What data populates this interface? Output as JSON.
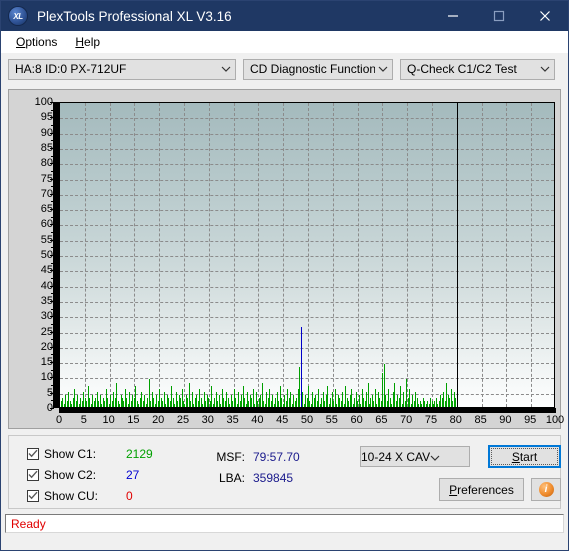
{
  "window": {
    "title": "PlexTools Professional XL V3.16",
    "app_icon": "xl-logo-icon",
    "minimize": "minimize-icon",
    "maximize": "maximize-icon",
    "close": "close-icon"
  },
  "menu": {
    "items": [
      {
        "label": "Options",
        "mnemonic": "O"
      },
      {
        "label": "Help",
        "mnemonic": "H"
      }
    ]
  },
  "toolbar": {
    "drive_select": "HA:8 ID:0  PX-712UF",
    "function_select": "CD Diagnostic Functions",
    "test_select": "Q-Check C1/C2 Test"
  },
  "panel": {
    "checkboxes": [
      {
        "label": "Show C1:",
        "value": "2129",
        "color": "#00a000",
        "checked": true
      },
      {
        "label": "Show C2:",
        "value": "27",
        "color": "#0000d0",
        "checked": true
      },
      {
        "label": "Show CU:",
        "value": "0",
        "color": "#e00000",
        "checked": true
      }
    ],
    "msf_key": "MSF:",
    "msf_value": "79:57.70",
    "lba_key": "LBA:",
    "lba_value": "359845",
    "speed_select": "10-24 X CAV",
    "start_button": "Start",
    "preferences_button": "Preferences",
    "info_button": "info-icon"
  },
  "statusbar": {
    "text": "Ready"
  },
  "chart_data": {
    "type": "bar",
    "title": "Q-Check C1/C2 Test",
    "xlabel": "",
    "ylabel": "",
    "xlim": [
      0,
      100
    ],
    "ylim": [
      0,
      100
    ],
    "xticks": [
      0,
      5,
      10,
      15,
      20,
      25,
      30,
      35,
      40,
      45,
      50,
      55,
      60,
      65,
      70,
      75,
      80,
      85,
      90,
      95,
      100
    ],
    "yticks": [
      0,
      5,
      10,
      15,
      20,
      25,
      30,
      35,
      40,
      45,
      50,
      55,
      60,
      65,
      70,
      75,
      80,
      85,
      90,
      95,
      100
    ],
    "grid": true,
    "legend": [
      "C1",
      "C2",
      "CU"
    ],
    "legend_position": "bottom-left-panel",
    "data_end_marker": 80,
    "series": [
      {
        "name": "C1",
        "color": "#00a000",
        "x": [
          0.2,
          0.5,
          0.8,
          1.1,
          1.4,
          1.7,
          2.0,
          2.3,
          2.6,
          2.9,
          3.2,
          3.5,
          3.8,
          4.1,
          4.4,
          4.7,
          5.0,
          5.3,
          5.6,
          5.9,
          6.2,
          6.5,
          6.8,
          7.1,
          7.4,
          7.7,
          8.0,
          8.3,
          8.6,
          8.9,
          9.2,
          9.5,
          9.8,
          10.1,
          10.4,
          10.7,
          11.0,
          11.3,
          11.6,
          11.9,
          12.2,
          12.5,
          12.8,
          13.1,
          13.4,
          13.7,
          14.0,
          14.3,
          14.6,
          14.9,
          15.2,
          15.5,
          15.8,
          16.1,
          16.4,
          16.7,
          17.0,
          17.3,
          17.6,
          17.9,
          18.2,
          18.5,
          18.8,
          19.1,
          19.4,
          19.7,
          20.0,
          20.3,
          20.6,
          20.9,
          21.2,
          21.5,
          21.8,
          22.1,
          22.4,
          22.7,
          23.0,
          23.3,
          23.6,
          23.9,
          24.2,
          24.5,
          24.8,
          25.1,
          25.4,
          25.7,
          26.0,
          26.3,
          26.6,
          26.9,
          27.2,
          27.5,
          27.8,
          28.1,
          28.4,
          28.7,
          29.0,
          29.3,
          29.6,
          29.9,
          30.2,
          30.5,
          30.8,
          31.1,
          31.4,
          31.7,
          32.0,
          32.3,
          32.6,
          32.9,
          33.2,
          33.5,
          33.8,
          34.1,
          34.4,
          34.7,
          35.0,
          35.3,
          35.6,
          35.9,
          36.2,
          36.5,
          36.8,
          37.1,
          37.4,
          37.7,
          38.0,
          38.3,
          38.6,
          38.9,
          39.2,
          39.5,
          39.8,
          40.1,
          40.4,
          40.7,
          41.0,
          41.3,
          41.6,
          41.9,
          42.2,
          42.5,
          42.8,
          43.1,
          43.4,
          43.7,
          44.0,
          44.3,
          44.6,
          44.9,
          45.2,
          45.5,
          45.8,
          46.1,
          46.4,
          46.7,
          47.0,
          47.3,
          47.6,
          47.9,
          48.2,
          48.5,
          48.8,
          49.1,
          49.4,
          49.7,
          50.0,
          50.3,
          50.6,
          50.9,
          51.2,
          51.5,
          51.8,
          52.1,
          52.4,
          52.7,
          53.0,
          53.3,
          53.6,
          53.9,
          54.2,
          54.5,
          54.8,
          55.1,
          55.4,
          55.7,
          56.0,
          56.3,
          56.6,
          56.9,
          57.2,
          57.5,
          57.8,
          58.1,
          58.4,
          58.7,
          59.0,
          59.3,
          59.6,
          59.9,
          60.2,
          60.5,
          60.8,
          61.1,
          61.4,
          61.7,
          62.0,
          62.3,
          62.6,
          62.9,
          63.2,
          63.5,
          63.8,
          64.1,
          64.4,
          64.7,
          65.0,
          65.3,
          65.6,
          65.9,
          66.2,
          66.5,
          66.8,
          67.1,
          67.4,
          67.7,
          68.0,
          68.3,
          68.6,
          68.9,
          69.2,
          69.5,
          69.8,
          70.1,
          70.4,
          70.7,
          71.0,
          71.3,
          71.6,
          71.9,
          72.2,
          72.5,
          72.8,
          73.1,
          73.4,
          73.7,
          74.0,
          74.3,
          74.6,
          74.9,
          75.2,
          75.5,
          75.8,
          76.1,
          76.4,
          76.7,
          77.0,
          77.3,
          77.6,
          77.9,
          78.2,
          78.5,
          78.8,
          79.1,
          79.4,
          79.7
        ],
        "values": [
          2,
          3,
          1,
          4,
          2,
          5,
          2,
          1,
          3,
          6,
          2,
          4,
          1,
          3,
          2,
          5,
          3,
          2,
          7,
          3,
          1,
          4,
          2,
          3,
          5,
          2,
          4,
          1,
          3,
          2,
          6,
          3,
          1,
          4,
          2,
          5,
          3,
          8,
          2,
          1,
          4,
          3,
          2,
          6,
          3,
          1,
          5,
          2,
          4,
          3,
          7,
          2,
          1,
          3,
          5,
          2,
          4,
          1,
          3,
          9,
          2,
          5,
          3,
          1,
          4,
          2,
          6,
          3,
          2,
          5,
          1,
          4,
          3,
          2,
          7,
          3,
          1,
          5,
          2,
          4,
          3,
          6,
          2,
          1,
          4,
          3,
          8,
          2,
          5,
          1,
          3,
          4,
          2,
          6,
          3,
          1,
          5,
          2,
          4,
          3,
          2,
          7,
          1,
          3,
          5,
          2,
          4,
          1,
          6,
          3,
          2,
          5,
          3,
          1,
          4,
          2,
          6,
          3,
          1,
          5,
          2,
          4,
          7,
          3,
          1,
          5,
          2,
          4,
          3,
          6,
          1,
          5,
          2,
          3,
          4,
          8,
          2,
          1,
          5,
          3,
          6,
          2,
          4,
          1,
          3,
          5,
          2,
          7,
          3,
          1,
          4,
          2,
          6,
          3,
          5,
          1,
          4,
          2,
          3,
          6,
          13,
          2,
          5,
          1,
          4,
          3,
          7,
          2,
          1,
          5,
          3,
          4,
          2,
          6,
          1,
          3,
          5,
          2,
          4,
          7,
          1,
          3,
          5,
          2,
          6,
          1,
          4,
          3,
          2,
          5,
          1,
          7,
          3,
          2,
          4,
          6,
          1,
          3,
          5,
          2,
          4,
          1,
          6,
          3,
          2,
          5,
          8,
          1,
          3,
          4,
          2,
          6,
          1,
          5,
          3,
          2,
          11,
          14,
          4,
          2,
          6,
          3,
          1,
          5,
          8,
          2,
          4,
          3,
          7,
          1,
          5,
          2,
          9,
          3,
          6,
          1,
          4,
          2,
          5,
          3,
          1,
          2,
          1,
          3,
          2,
          1,
          2,
          1,
          3,
          2,
          1,
          2,
          3,
          1,
          2,
          4,
          3,
          5,
          2,
          8,
          4,
          3,
          6,
          2,
          5,
          3,
          4,
          7,
          2,
          5,
          3,
          6,
          4,
          2,
          5,
          3
        ]
      },
      {
        "name": "C2",
        "color": "#0000c8",
        "x": [
          48.5
        ],
        "values": [
          26
        ]
      },
      {
        "name": "CU",
        "color": "#d00000",
        "x": [],
        "values": []
      }
    ]
  }
}
